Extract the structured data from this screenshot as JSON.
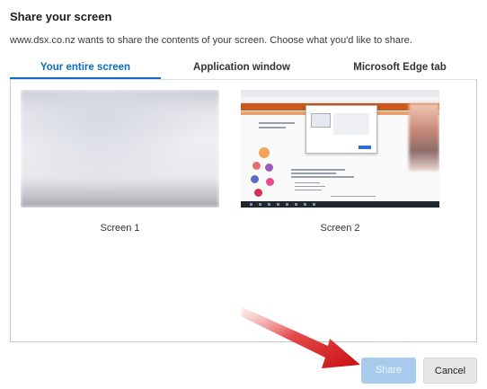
{
  "dialog": {
    "title": "Share your screen",
    "description": "www.dsx.co.nz wants to share the contents of your screen. Choose what you'd like to share."
  },
  "tabs": [
    {
      "label": "Your entire screen",
      "active": true
    },
    {
      "label": "Application window",
      "active": false
    },
    {
      "label": "Microsoft Edge tab",
      "active": false
    }
  ],
  "screens": [
    {
      "label": "Screen 1"
    },
    {
      "label": "Screen 2"
    }
  ],
  "buttons": {
    "share_label": "Share",
    "cancel_label": "Cancel"
  },
  "colors": {
    "accent": "#0f6cbd",
    "share_disabled": "#a9cbec",
    "annotation_arrow": "#e0161b"
  }
}
